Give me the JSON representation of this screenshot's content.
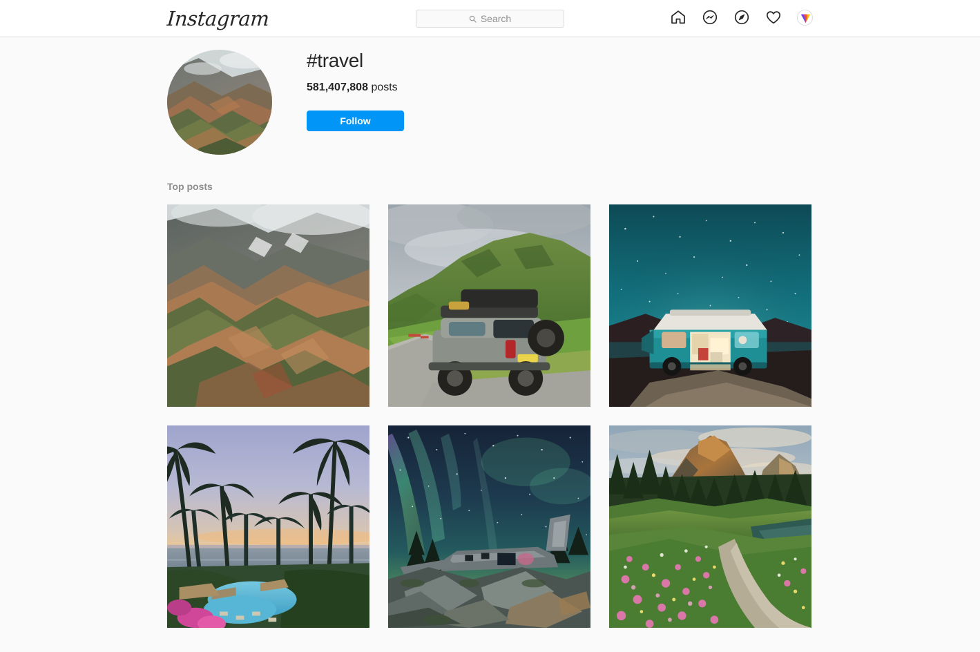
{
  "app": {
    "name": "Instagram",
    "logo_text": "Instagram"
  },
  "header": {
    "search": {
      "placeholder": "Search",
      "value": "",
      "icon": "search-icon"
    },
    "nav": [
      {
        "name": "home-icon",
        "label": "Home"
      },
      {
        "name": "messenger-icon",
        "label": "Messenger"
      },
      {
        "name": "explore-icon",
        "label": "Explore"
      },
      {
        "name": "activity-heart-icon",
        "label": "Activity"
      },
      {
        "name": "profile-avatar",
        "label": "Profile"
      }
    ]
  },
  "profile": {
    "avatar_name": "hashtag-avatar",
    "title": "#travel",
    "post_count": "581,407,808",
    "post_count_label": "posts",
    "follow_label": "Follow"
  },
  "posts_section": {
    "title": "Top posts",
    "tiles": [
      {
        "name": "post-tile-rhyolite-mountains",
        "alt": "Colorful rhyolite mountain ridges with green moss and misty peaks"
      },
      {
        "name": "post-tile-offroad-suv",
        "alt": "Silver off-road SUV with roof tent parked on a country road by a green hill"
      },
      {
        "name": "post-tile-camper-van-night",
        "alt": "Teal camper van lit up under a starry teal night sky"
      },
      {
        "name": "post-tile-palm-sunset",
        "alt": "Palm trees silhouetted over a resort pool at ocean sunset"
      },
      {
        "name": "post-tile-plane-wreck-aurora",
        "alt": "Abandoned plane wreck on rocks under green aurora borealis"
      },
      {
        "name": "post-tile-wildflower-trail",
        "alt": "Trail through pink wildflower meadow toward a sunlit mountain"
      }
    ]
  },
  "colors": {
    "brand_blue": "#0095f6",
    "page_background": "#fafafa",
    "header_background": "#ffffff",
    "border": "#dbdbdb",
    "text_primary": "#262626",
    "text_secondary": "#8e8e8e"
  }
}
